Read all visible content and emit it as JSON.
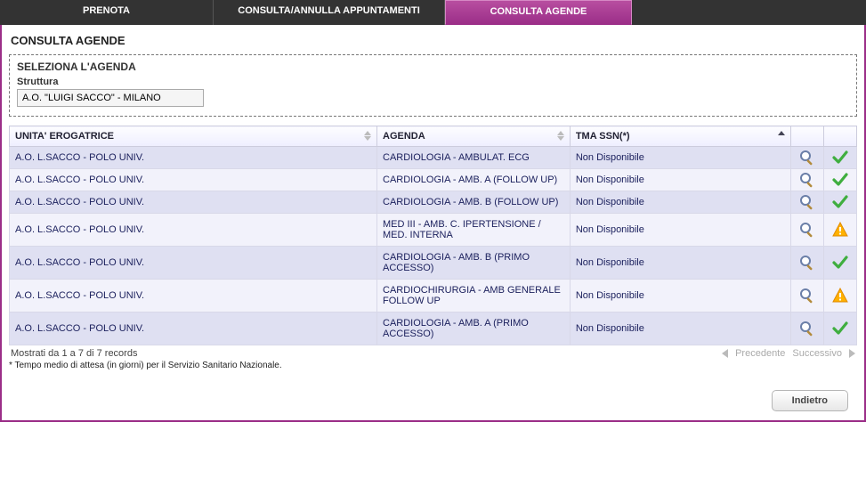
{
  "tabs": [
    {
      "label": "PRENOTA"
    },
    {
      "label": "CONSULTA/ANNULLA APPUNTAMENTI"
    },
    {
      "label": "CONSULTA AGENDE"
    }
  ],
  "active_tab_index": 2,
  "page_title": "CONSULTA AGENDE",
  "panel": {
    "title": "SELEZIONA L'AGENDA",
    "struttura_label": "Struttura",
    "struttura_value": "A.O. \"LUIGI SACCO\" - MILANO"
  },
  "columns": {
    "unit": "UNITA' EROGATRICE",
    "agenda": "AGENDA",
    "tma": "TMA SSN(*)",
    "sorted": "tma",
    "sorted_dir": "asc"
  },
  "rows": [
    {
      "unit": "A.O. L.SACCO - POLO UNIV.",
      "agenda": "CARDIOLOGIA - AMBULAT. ECG",
      "tma": "Non Disponibile",
      "status": "ok"
    },
    {
      "unit": "A.O. L.SACCO - POLO UNIV.",
      "agenda": "CARDIOLOGIA - AMB. A (FOLLOW UP)",
      "tma": "Non Disponibile",
      "status": "ok"
    },
    {
      "unit": "A.O. L.SACCO - POLO UNIV.",
      "agenda": "CARDIOLOGIA - AMB. B (FOLLOW UP)",
      "tma": "Non Disponibile",
      "status": "ok"
    },
    {
      "unit": "A.O. L.SACCO - POLO UNIV.",
      "agenda": "MED III - AMB. C. IPERTENSIONE / MED. INTERNA",
      "tma": "Non Disponibile",
      "status": "warn"
    },
    {
      "unit": "A.O. L.SACCO - POLO UNIV.",
      "agenda": "CARDIOLOGIA - AMB. B (PRIMO ACCESSO)",
      "tma": "Non Disponibile",
      "status": "ok"
    },
    {
      "unit": "A.O. L.SACCO - POLO UNIV.",
      "agenda": "CARDIOCHIRURGIA - AMB GENERALE FOLLOW UP",
      "tma": "Non Disponibile",
      "status": "warn"
    },
    {
      "unit": "A.O. L.SACCO - POLO UNIV.",
      "agenda": "CARDIOLOGIA - AMB. A (PRIMO ACCESSO)",
      "tma": "Non Disponibile",
      "status": "ok"
    }
  ],
  "pager": {
    "info": "Mostrati da 1 a 7 di 7 records",
    "prev": "Precedente",
    "next": "Successivo"
  },
  "footnote": "* Tempo medio di attesa (in giorni) per il Servizio Sanitario Nazionale.",
  "buttons": {
    "back": "Indietro"
  }
}
